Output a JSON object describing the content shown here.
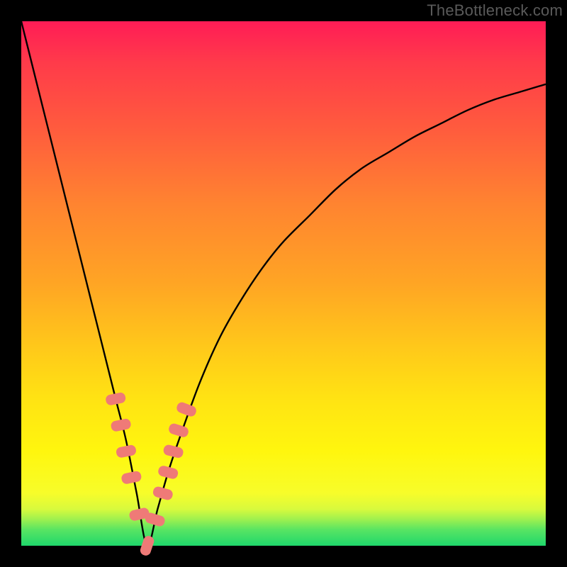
{
  "watermark": "TheBottleneck.com",
  "chart_data": {
    "type": "line",
    "title": "",
    "xlabel": "",
    "ylabel": "",
    "xlim": [
      0,
      100
    ],
    "ylim": [
      0,
      100
    ],
    "note": "V-shaped bottleneck curve; y ≈ 0 at x ≈ 24 (optimal match). Values estimated from gradient height.",
    "series": [
      {
        "name": "bottleneck-curve",
        "x": [
          0,
          2,
          4,
          6,
          8,
          10,
          12,
          14,
          16,
          18,
          20,
          22,
          24,
          26,
          28,
          30,
          34,
          38,
          42,
          46,
          50,
          55,
          60,
          65,
          70,
          75,
          80,
          85,
          90,
          95,
          100
        ],
        "values": [
          100,
          92,
          84,
          76,
          68,
          60,
          52,
          44,
          36,
          28,
          20,
          10,
          0,
          7,
          14,
          20,
          31,
          40,
          47,
          53,
          58,
          63,
          68,
          72,
          75,
          78,
          80.5,
          83,
          85,
          86.5,
          88
        ]
      }
    ],
    "markers": {
      "name": "highlight-points",
      "x": [
        18,
        19,
        20,
        21,
        22.5,
        24,
        25.5,
        27,
        28,
        29,
        30,
        31.5
      ],
      "values": [
        28,
        23,
        18,
        13,
        6,
        0,
        5,
        10,
        14,
        18,
        22,
        26
      ]
    },
    "gradient_stops": [
      {
        "pct": 0,
        "color": "#ff1c56"
      },
      {
        "pct": 50,
        "color": "#ffa524"
      },
      {
        "pct": 82,
        "color": "#fff60e"
      },
      {
        "pct": 100,
        "color": "#1fd76b"
      }
    ]
  }
}
